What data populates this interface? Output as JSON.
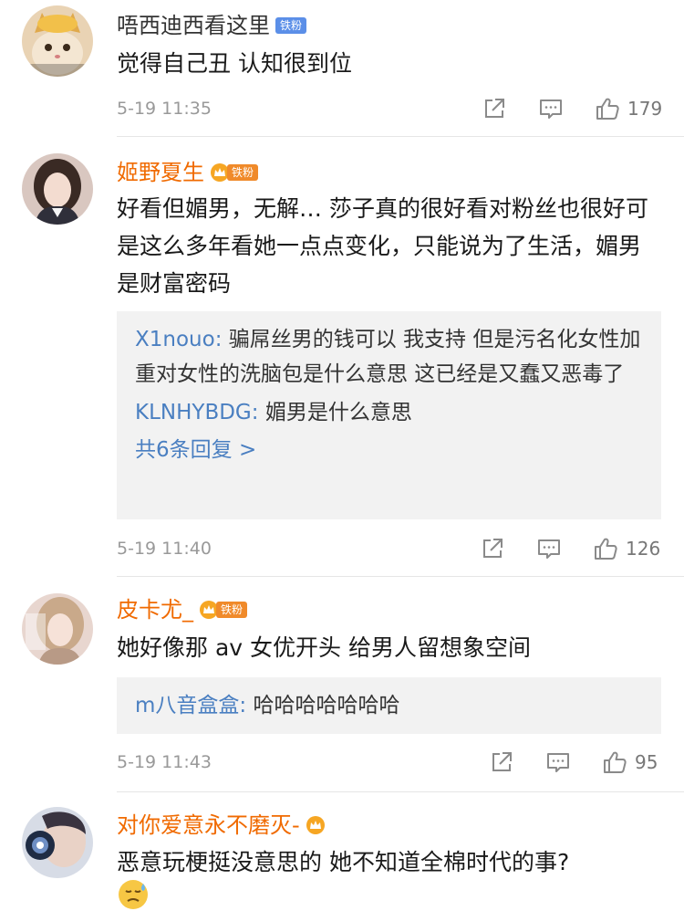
{
  "comments": [
    {
      "username": "唔西迪西看这里",
      "badge": "铁粉",
      "text": "觉得自己丑 认知很到位",
      "time": "5-19 11:35",
      "likes": "179",
      "avatar_icon": "cat-avatar-icon"
    },
    {
      "username": "姬野夏生",
      "badge": "铁粉",
      "text": "好看但媚男，无解… 莎子真的很好看对粉丝也很好可是这么多年看她一点点变化，只能说为了生活，媚男是财富密码",
      "replies": [
        {
          "name": "X1nouo:",
          "text": " 骗屌丝男的钱可以 我支持 但是污名化女性加重对女性的洗脑包是什么意思 这已经是又蠢又恶毒了"
        },
        {
          "name": "KLNHYBDG:",
          "text": " 媚男是什么意思"
        }
      ],
      "more": "共6条回复 >",
      "time": "5-19 11:40",
      "likes": "126"
    },
    {
      "username": "皮卡尤_",
      "badge": "铁粉",
      "text": "她好像那 av 女优开头 给男人留想象空间",
      "replies": [
        {
          "name": "m八音盒盒:",
          "text": " 哈哈哈哈哈哈哈"
        }
      ],
      "time": "5-19 11:43",
      "likes": "95"
    },
    {
      "username": "对你爱意永不磨灭-",
      "text": "恶意玩梗挺没意思的 她不知道全棉时代的事?"
    }
  ],
  "colors": {
    "vip_name": "#f06a00",
    "reply_name": "#4a7fc1",
    "meta": "#999999",
    "reply_bg": "#f2f2f2"
  }
}
